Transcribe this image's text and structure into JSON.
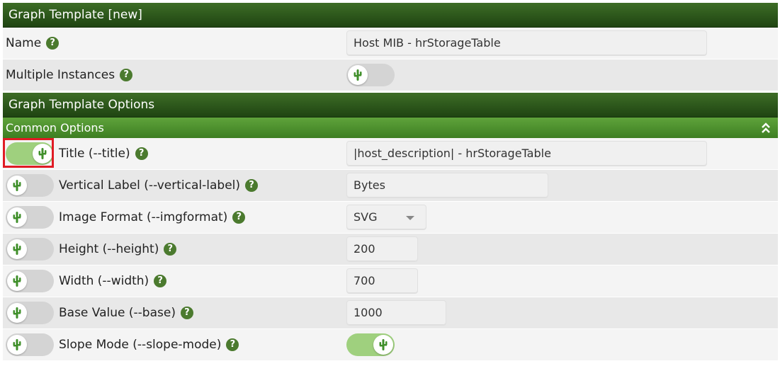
{
  "graph_template": {
    "header": "Graph Template [new]",
    "name_label": "Name",
    "name_value": "Host MIB - hrStorageTable",
    "multiple_instances_label": "Multiple Instances",
    "multiple_instances_on": false
  },
  "options": {
    "header": "Graph Template Options",
    "common_header": "Common Options",
    "rows": [
      {
        "label": "Title (--title)",
        "value": "|host_description| - hrStorageTable",
        "override_on": true
      },
      {
        "label": "Vertical Label (--vertical-label)",
        "value": "Bytes",
        "override_on": false
      },
      {
        "label": "Image Format (--imgformat)",
        "value": "SVG",
        "override_on": false
      },
      {
        "label": "Height (--height)",
        "value": "200",
        "override_on": false
      },
      {
        "label": "Width (--width)",
        "value": "700",
        "override_on": false
      },
      {
        "label": "Base Value (--base)",
        "value": "1000",
        "override_on": false
      },
      {
        "label": "Slope Mode (--slope-mode)",
        "value_on": true,
        "override_on": false
      }
    ]
  },
  "icons": {
    "toggle_knob": "cactus-icon",
    "help": "question-icon",
    "collapse": "double-chevron-up-icon"
  },
  "colors": {
    "header_dark": "#2c5a1c",
    "header_green": "#4e9330",
    "toggle_on": "#9fd07e",
    "toggle_off": "#d4d4d4",
    "highlight": "#e01b24"
  }
}
